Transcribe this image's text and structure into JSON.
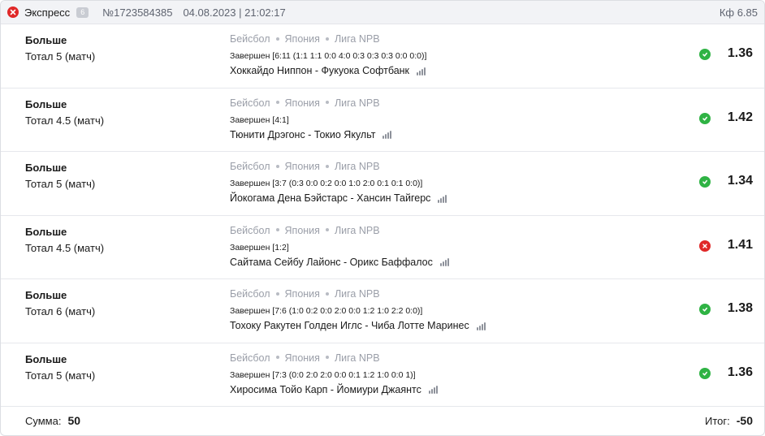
{
  "header": {
    "type": "Экспресс",
    "count": "6",
    "number": "№1723584385",
    "datetime": "04.08.2023 | 21:02:17",
    "kf": "Кф 6.85"
  },
  "colors": {
    "win": "#2fb344",
    "loss": "#e02828"
  },
  "bets": [
    {
      "type": "Больше",
      "market": "Тотал 5 (матч)",
      "sport": "Бейсбол",
      "country": "Япония",
      "league": "Лига NPB",
      "score": "Завершен [6:11 (1:1 1:1 0:0 4:0 0:3 0:3 0:3 0:0 0:0)]",
      "match": "Хоккайдо Ниппон - Фукуока Софтбанк",
      "result": "win",
      "odds": "1.36"
    },
    {
      "type": "Больше",
      "market": "Тотал 4.5 (матч)",
      "sport": "Бейсбол",
      "country": "Япония",
      "league": "Лига NPB",
      "score": "Завершен [4:1]",
      "match": "Тюнити Дрэгонс - Токио Якульт",
      "result": "win",
      "odds": "1.42"
    },
    {
      "type": "Больше",
      "market": "Тотал 5 (матч)",
      "sport": "Бейсбол",
      "country": "Япония",
      "league": "Лига NPB",
      "score": "Завершен [3:7 (0:3 0:0 0:2 0:0 1:0 2:0 0:1 0:1 0:0)]",
      "match": "Йокогама Дена Бэйстарс - Хансин Тайгерс",
      "result": "win",
      "odds": "1.34"
    },
    {
      "type": "Больше",
      "market": "Тотал 4.5 (матч)",
      "sport": "Бейсбол",
      "country": "Япония",
      "league": "Лига NPB",
      "score": "Завершен [1:2]",
      "match": "Сайтама Сейбу Лайонс - Орикс Баффалос",
      "result": "loss",
      "odds": "1.41"
    },
    {
      "type": "Больше",
      "market": "Тотал 6 (матч)",
      "sport": "Бейсбол",
      "country": "Япония",
      "league": "Лига NPB",
      "score": "Завершен [7:6 (1:0 0:2 0:0 2:0 0:0 1:2 1:0 2:2 0:0)]",
      "match": "Тохоку Ракутен Голден Иглс - Чиба Лотте Маринес",
      "result": "win",
      "odds": "1.38"
    },
    {
      "type": "Больше",
      "market": "Тотал 5 (матч)",
      "sport": "Бейсбол",
      "country": "Япония",
      "league": "Лига NPB",
      "score": "Завершен [7:3 (0:0 2:0 2:0 0:0 0:1 1:2 1:0 0:0 1)]",
      "match": "Хиросима Тойо Карп - Йомиури Джаянтс",
      "result": "win",
      "odds": "1.36"
    }
  ],
  "footer": {
    "sum_label": "Сумма:",
    "sum_value": "50",
    "total_label": "Итог:",
    "total_value": "-50"
  }
}
